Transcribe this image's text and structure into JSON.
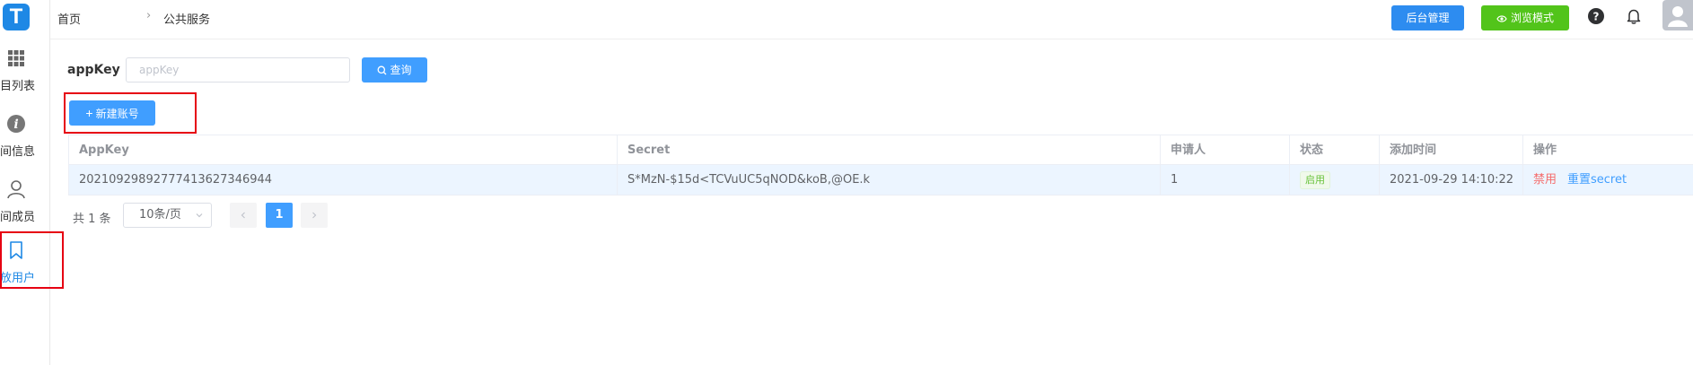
{
  "sidebar": {
    "logo_text": "T",
    "items": [
      {
        "label": "项目列表",
        "icon": "grid-icon"
      },
      {
        "label": "空间信息",
        "icon": "info-icon"
      },
      {
        "label": "空间成员",
        "icon": "user-icon"
      },
      {
        "label": "开放用户",
        "icon": "bookmark-icon",
        "active": true
      }
    ]
  },
  "header": {
    "breadcrumb": [
      "首页",
      "公共服务"
    ],
    "admin_button": "后台管理",
    "browse_button": "浏览模式",
    "icons": [
      "help-icon",
      "bell-icon",
      "avatar"
    ]
  },
  "search": {
    "label": "appKey",
    "placeholder": "appKey",
    "value": "",
    "query_button": "查询"
  },
  "toolbar": {
    "new_account_button": "新建账号"
  },
  "table": {
    "columns": [
      "AppKey",
      "Secret",
      "申请人",
      "状态",
      "添加时间",
      "操作"
    ],
    "rows": [
      {
        "appkey": "20210929892777413627346944",
        "secret": "S*MzN-$15d<TCVuUC5qNOD&koB,@OE.k",
        "applicant": "1",
        "status": "启用",
        "added_time": "2021-09-29 14:10:22",
        "actions": [
          "禁用",
          "重置secret"
        ]
      }
    ]
  },
  "pagination": {
    "total": "共 1 条",
    "page_size": "10条/页",
    "current_page": "1"
  },
  "colors": {
    "primary": "#409eff",
    "admin_button": "#2d8cf0",
    "browse_button": "#52c41a",
    "highlight_box": "#e60012",
    "row_highlight": "#ecf5ff",
    "danger": "#f56c6c",
    "success": "#67c23a"
  }
}
